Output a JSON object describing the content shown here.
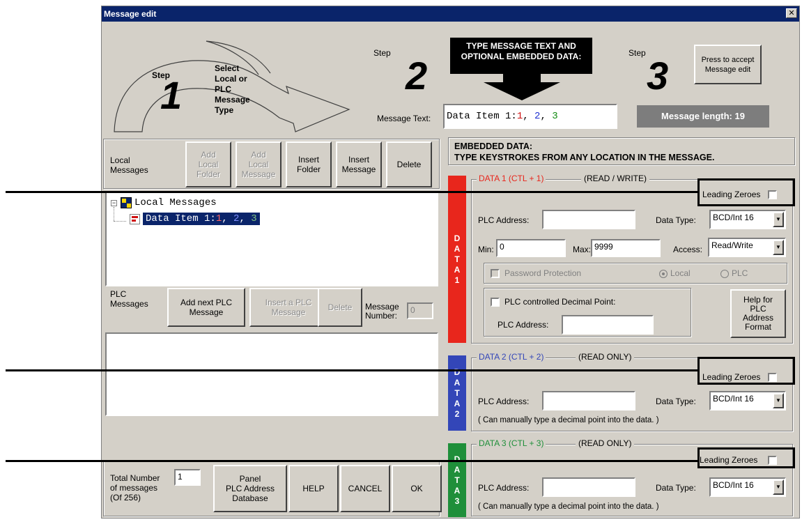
{
  "window": {
    "title": "Message edit",
    "close_glyph": "✕"
  },
  "header": {
    "step_word": "Step",
    "step1": {
      "number": "1",
      "text": "Select\nLocal or\nPLC\nMessage\nType"
    },
    "step2": {
      "number": "2"
    },
    "step3": {
      "number": "3"
    },
    "banner": "TYPE MESSAGE TEXT AND\nOPTIONAL EMBEDDED DATA:",
    "accept_button": "Press to accept\nMessage edit",
    "message_text_label": "Message Text:",
    "message_text": {
      "prefix": "Data Item 1:",
      "n1": "1",
      "n2": "2",
      "n3": "3"
    },
    "message_length": "Message length: 19"
  },
  "local": {
    "label": "Local\nMessages",
    "buttons": [
      "Add\nLocal\nFolder",
      "Add\nLocal\nMessage",
      "Insert\nFolder",
      "Insert\nMessage",
      "Delete"
    ],
    "tree_root": "Local Messages",
    "tree_item": {
      "prefix": "Data Item 1:",
      "n1": "1",
      "n2": "2",
      "n3": "3"
    }
  },
  "plc": {
    "label": "PLC\nMessages",
    "buttons": [
      "Add next PLC\nMessage",
      "Insert a PLC\nMessage",
      "Delete"
    ],
    "message_number_label": "Message\nNumber:",
    "message_number": "0"
  },
  "footer": {
    "total_label": "Total Number\nof messages\n(Of 256)",
    "total_value": "1",
    "panel_button": "Panel\nPLC Address\nDatabase",
    "help_button": "HELP",
    "cancel_button": "CANCEL",
    "ok_button": "OK"
  },
  "embedded": {
    "title": "EMBEDDED DATA:\nTYPE KEYSTROKES FROM ANY LOCATION IN THE MESSAGE.",
    "leading_zeroes": "Leading Zeroes",
    "plc_address_label": "PLC Address:",
    "data_type_label": "Data Type:",
    "data_type_value": "BCD/Int 16",
    "manual_note": "( Can manually type a decimal point into the data. )",
    "data1": {
      "tab": [
        "D",
        "A",
        "T",
        "A",
        "1"
      ],
      "title": "DATA 1 (CTL + 1)",
      "mode": "(READ / WRITE)",
      "min_label": "Min:",
      "min_value": "0",
      "max_label": "Max:",
      "max_value": "9999",
      "access_label": "Access:",
      "access_value": "Read/Write",
      "password_label": "Password Protection",
      "radio_local": "Local",
      "radio_plc": "PLC",
      "decimal_label": "PLC controlled Decimal Point:",
      "decimal_address_label": "PLC Address:",
      "help_format_button": "Help for\nPLC\nAddress\nFormat"
    },
    "data2": {
      "tab": [
        "D",
        "A",
        "T",
        "A",
        "2"
      ],
      "title": "DATA 2 (CTL + 2)",
      "mode": "(READ ONLY)"
    },
    "data3": {
      "tab": [
        "D",
        "A",
        "T",
        "A",
        "3"
      ],
      "title": "DATA 3 (CTL + 3)",
      "mode": "(READ ONLY)"
    }
  },
  "colors": {
    "titlebar": "#0a246a",
    "data1": "#e8261c",
    "data2": "#3346b8",
    "data3": "#1f8f3a",
    "num1": "#d01010",
    "num2": "#1f2fd0",
    "num3": "#108a10",
    "length_bg": "#7d7d7d",
    "banner_bg": "#000000"
  }
}
